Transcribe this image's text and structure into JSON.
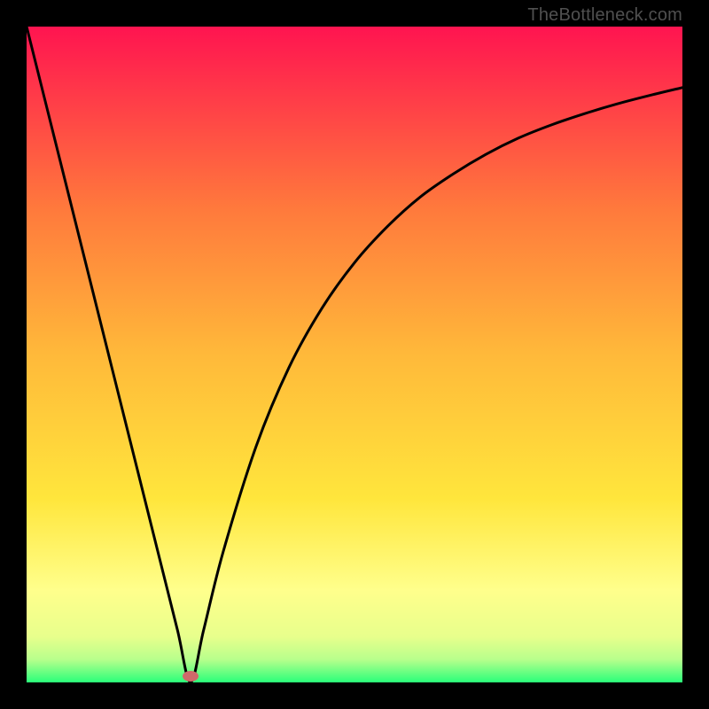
{
  "attribution": "TheBottleneck.com",
  "colors": {
    "black": "#000000",
    "grad_top": "#ff1450",
    "grad_mid_upper": "#ff7a3c",
    "grad_mid": "#ffb93a",
    "grad_mid_lower": "#ffe63c",
    "grad_yellow_pale": "#ffff8c",
    "grad_green_pale": "#b8ff8c",
    "grad_green": "#2aff7a",
    "marker": "#cf6a6a",
    "curve": "#000000"
  },
  "chart_data": {
    "type": "line",
    "title": "",
    "xlabel": "",
    "ylabel": "",
    "x_range": [
      0,
      100
    ],
    "y_range": [
      0,
      100
    ],
    "optimum_x": 25,
    "marker": {
      "x": 25,
      "y": 1
    },
    "series": [
      {
        "name": "bottleneck-curve",
        "x": [
          0,
          5,
          10,
          15,
          20,
          23,
          25,
          27,
          30,
          35,
          40,
          45,
          50,
          55,
          60,
          65,
          70,
          75,
          80,
          85,
          90,
          95,
          100
        ],
        "y": [
          100,
          80,
          60,
          40,
          20,
          8,
          0,
          8,
          20,
          36,
          48,
          57,
          64,
          69.5,
          74,
          77.5,
          80.5,
          83,
          85,
          86.7,
          88.2,
          89.5,
          90.7
        ]
      }
    ],
    "gradient_stops": [
      {
        "pct": 0,
        "color": "#ff1450"
      },
      {
        "pct": 28,
        "color": "#ff7a3c"
      },
      {
        "pct": 50,
        "color": "#ffb93a"
      },
      {
        "pct": 72,
        "color": "#ffe63c"
      },
      {
        "pct": 86,
        "color": "#ffff8c"
      },
      {
        "pct": 93,
        "color": "#e8ff8c"
      },
      {
        "pct": 96.5,
        "color": "#b8ff8c"
      },
      {
        "pct": 100,
        "color": "#2aff7a"
      }
    ]
  }
}
